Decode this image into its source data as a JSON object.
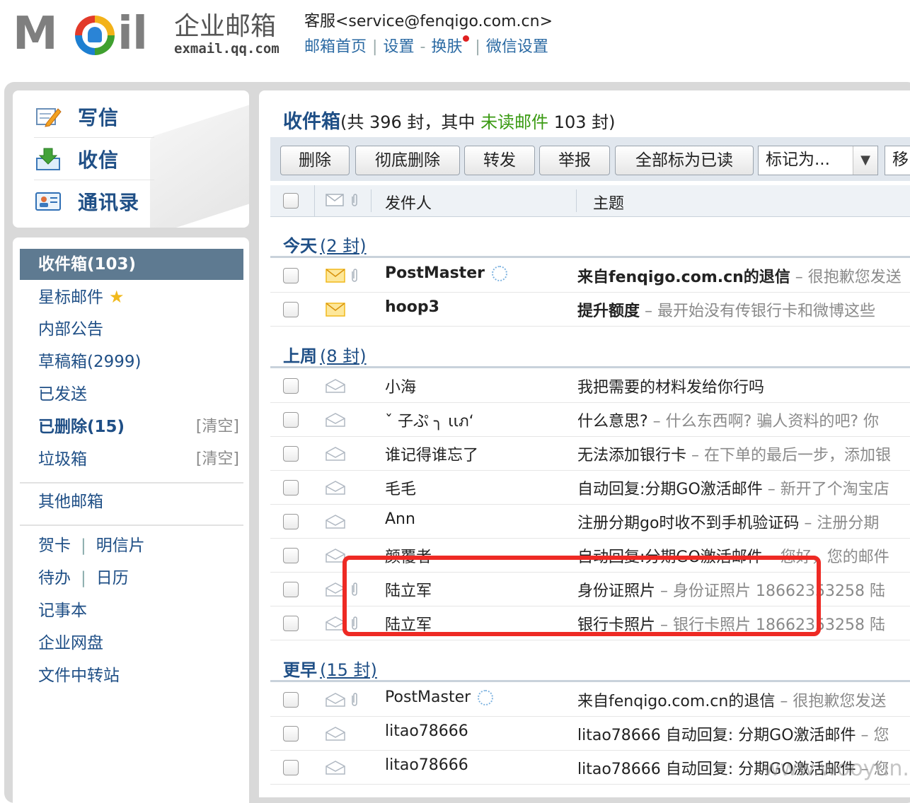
{
  "header": {
    "logo_word_left": "M",
    "logo_word_right": "il",
    "logo_cn": "企业邮箱",
    "logo_url": "exmail.qq.com",
    "user": "客服<service@fenqigo.com.cn>",
    "links": [
      "邮箱首页",
      "设置",
      "换肤",
      "微信设置"
    ],
    "link_separators": [
      "|",
      "-",
      "|"
    ]
  },
  "quick_actions": [
    {
      "label": "写信",
      "icon": "compose-icon"
    },
    {
      "label": "收信",
      "icon": "receive-icon"
    },
    {
      "label": "通讯录",
      "icon": "contacts-icon"
    }
  ],
  "folders": {
    "inbox": "收件箱(103)",
    "starred": "星标邮件",
    "notice": "内部公告",
    "drafts": "草稿箱(2999)",
    "sent": "已发送",
    "deleted": "已删除(15)",
    "deleted_action": "[清空]",
    "trash": "垃圾箱",
    "trash_action": "[清空]",
    "other": "其他邮箱",
    "card": "贺卡",
    "postcard": "明信片",
    "todo": "待办",
    "calendar": "日历",
    "notes": "记事本",
    "disk": "企业网盘",
    "transfer": "文件中转站",
    "pipe": "|"
  },
  "main": {
    "title": "收件箱",
    "summary_pre": "(共 396 封，其中 ",
    "summary_unread": "未读邮件",
    "summary_post": " 103 封)",
    "toolbar": {
      "delete": "删除",
      "purge": "彻底删除",
      "forward": "转发",
      "report": "举报",
      "mark_all_read": "全部标为已读",
      "mark_as": "标记为...",
      "move": "移"
    },
    "columns": {
      "from": "发件人",
      "subject": "主题"
    }
  },
  "groups": [
    {
      "label": "今天",
      "count": "(2 封)"
    },
    {
      "label": "上周",
      "count": "(8 封)"
    },
    {
      "label": "更早",
      "count": "(15 封)"
    }
  ],
  "emails": [
    {
      "from": "PostMaster",
      "subject": "来自fenqigo.com.cn的退信",
      "preview": " – 很抱歉您发送",
      "unread": true,
      "attach": true,
      "system": true
    },
    {
      "from": "hoop3",
      "subject": "提升额度",
      "preview": " – 最开始没有传银行卡和微博这些",
      "unread": true,
      "attach": false,
      "system": false
    },
    {
      "from": "小海",
      "subject": "我把需要的材料发给你行吗",
      "preview": "",
      "unread": false,
      "attach": false,
      "system": false
    },
    {
      "from": "ˇ 子ぷ ╮ ιιภ‘",
      "subject": "什么意思?",
      "preview": " – 什么东西啊? 骗人资料的吧? 你",
      "unread": false,
      "attach": false,
      "system": false
    },
    {
      "from": "谁记得谁忘了",
      "subject": "无法添加银行卡",
      "preview": " – 在下单的最后一步，添加银",
      "unread": false,
      "attach": false,
      "system": false
    },
    {
      "from": "毛毛",
      "subject": "自动回复:分期GO激活邮件",
      "preview": " – 新开了个淘宝店",
      "unread": false,
      "attach": false,
      "system": false
    },
    {
      "from": "Ann",
      "subject": "注册分期go时收不到手机验证码",
      "preview": " – 注册分期",
      "unread": false,
      "attach": false,
      "system": false
    },
    {
      "from": "颜覆者",
      "subject": "自动回复:分期GO激活邮件",
      "preview": " – 您好，您的邮件",
      "unread": false,
      "attach": false,
      "system": false
    },
    {
      "from": "陆立军",
      "subject": "身份证照片",
      "preview": " – 身份证照片 18662353258 陆",
      "unread": false,
      "attach": true,
      "system": false
    },
    {
      "from": "陆立军",
      "subject": "银行卡照片",
      "preview": " – 银行卡照片 18662353258 陆",
      "unread": false,
      "attach": true,
      "system": false
    },
    {
      "from": "PostMaster",
      "subject": "来自fenqigo.com.cn的退信",
      "preview": " – 很抱歉您发送",
      "unread": false,
      "attach": true,
      "system": true
    },
    {
      "from": "litao78666",
      "subject": "litao78666 自动回复: 分期GO激活邮件",
      "preview": " – 您",
      "unread": false,
      "attach": false,
      "system": false
    },
    {
      "from": "litao78666",
      "subject": "litao78666 自动回复: 分期GO激活邮件",
      "preview": " – 您",
      "unread": false,
      "attach": false,
      "system": false
    }
  ],
  "watermark": "www.wooyun.org",
  "colors": {
    "accent": "#1f4f86",
    "active_folder": "#5e7a91",
    "unread_green": "#3a9a12",
    "highlight_red": "#ee2a24"
  }
}
